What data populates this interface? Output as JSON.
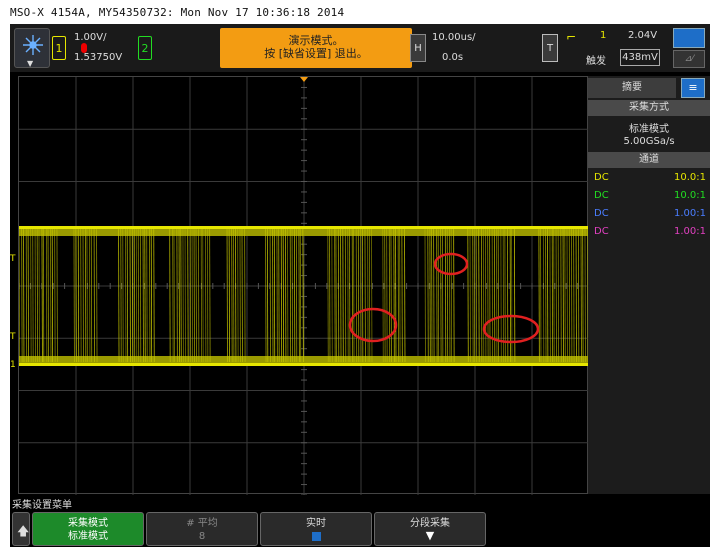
{
  "caption": "MSO-X 4154A, MY54350732: Mon Nov 17 10:36:18 2014",
  "topbar": {
    "ch1_number": "1",
    "ch1_scale": "1.00V/",
    "ch1_offset": "1.53750V",
    "ch2_number": "2",
    "demo_line1": "演示模式。",
    "demo_line2": "按 [缺省设置] 退出。",
    "h_label": "H",
    "timebase": "10.00us/",
    "delay": "0.0s",
    "t_label": "T",
    "trigger_source": "1",
    "trigger_level": "2.04V",
    "trigger_label": "触发",
    "trigger_value": "438mV"
  },
  "panel": {
    "tab_label": "摘要",
    "acq_header": "采集方式",
    "acq_mode": "标准模式",
    "sample_rate": "5.00GSa/s",
    "channels_header": "通道",
    "channels": [
      {
        "coupling": "DC",
        "probe": "10.0:1",
        "color": "#e6e600"
      },
      {
        "coupling": "DC",
        "probe": "10.0:1",
        "color": "#22dd22"
      },
      {
        "coupling": "DC",
        "probe": "1.00:1",
        "color": "#4a7dff"
      },
      {
        "coupling": "DC",
        "probe": "1.00:1",
        "color": "#e040c0"
      }
    ]
  },
  "menu": {
    "title": "采集设置菜单",
    "softkeys": [
      {
        "title": "采集模式",
        "value": "标准模式"
      },
      {
        "title": "# 平均",
        "value": "8"
      },
      {
        "title": "实时",
        "value": ""
      },
      {
        "title": "分段采集",
        "value": ""
      }
    ]
  },
  "markers": {
    "trig_marker_1": "T",
    "trig_marker_2": "T",
    "ground_marker": "1"
  }
}
